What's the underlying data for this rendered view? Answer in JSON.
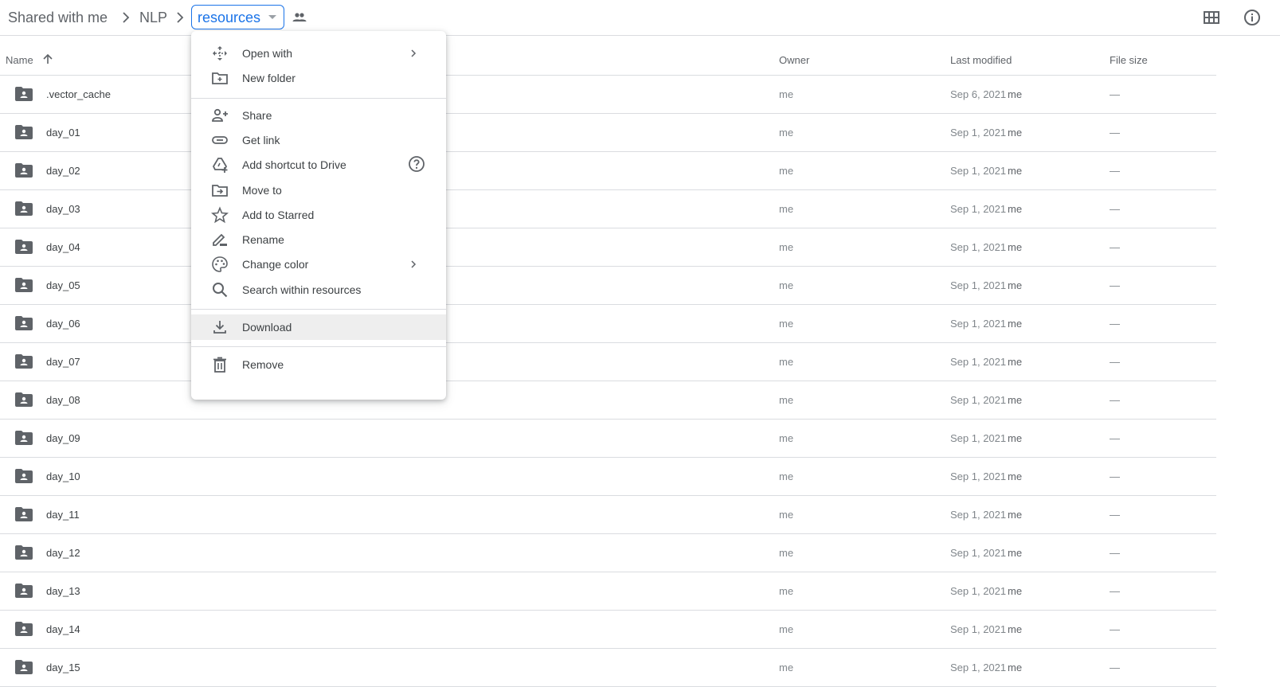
{
  "breadcrumb": {
    "items": [
      "Shared with me",
      "NLP"
    ],
    "current": "resources"
  },
  "toolbar": {
    "grid_view_icon": "grid-view-icon",
    "info_icon": "info-icon"
  },
  "table": {
    "columns": {
      "name": "Name",
      "owner": "Owner",
      "last_modified": "Last modified",
      "file_size": "File size"
    },
    "sort": "ascending",
    "rows": [
      {
        "name": ".vector_cache",
        "owner": "me",
        "date": "Sep 6, 2021",
        "modified_by": "me",
        "size": "—"
      },
      {
        "name": "day_01",
        "owner": "me",
        "date": "Sep 1, 2021",
        "modified_by": "me",
        "size": "—"
      },
      {
        "name": "day_02",
        "owner": "me",
        "date": "Sep 1, 2021",
        "modified_by": "me",
        "size": "—"
      },
      {
        "name": "day_03",
        "owner": "me",
        "date": "Sep 1, 2021",
        "modified_by": "me",
        "size": "—"
      },
      {
        "name": "day_04",
        "owner": "me",
        "date": "Sep 1, 2021",
        "modified_by": "me",
        "size": "—"
      },
      {
        "name": "day_05",
        "owner": "me",
        "date": "Sep 1, 2021",
        "modified_by": "me",
        "size": "—"
      },
      {
        "name": "day_06",
        "owner": "me",
        "date": "Sep 1, 2021",
        "modified_by": "me",
        "size": "—"
      },
      {
        "name": "day_07",
        "owner": "me",
        "date": "Sep 1, 2021",
        "modified_by": "me",
        "size": "—"
      },
      {
        "name": "day_08",
        "owner": "me",
        "date": "Sep 1, 2021",
        "modified_by": "me",
        "size": "—"
      },
      {
        "name": "day_09",
        "owner": "me",
        "date": "Sep 1, 2021",
        "modified_by": "me",
        "size": "—"
      },
      {
        "name": "day_10",
        "owner": "me",
        "date": "Sep 1, 2021",
        "modified_by": "me",
        "size": "—"
      },
      {
        "name": "day_11",
        "owner": "me",
        "date": "Sep 1, 2021",
        "modified_by": "me",
        "size": "—"
      },
      {
        "name": "day_12",
        "owner": "me",
        "date": "Sep 1, 2021",
        "modified_by": "me",
        "size": "—"
      },
      {
        "name": "day_13",
        "owner": "me",
        "date": "Sep 1, 2021",
        "modified_by": "me",
        "size": "—"
      },
      {
        "name": "day_14",
        "owner": "me",
        "date": "Sep 1, 2021",
        "modified_by": "me",
        "size": "—"
      },
      {
        "name": "day_15",
        "owner": "me",
        "date": "Sep 1, 2021",
        "modified_by": "me",
        "size": "—"
      }
    ]
  },
  "context_menu": {
    "items": [
      {
        "label": "Open with",
        "icon": "open-with-icon",
        "submenu": true
      },
      {
        "label": "New folder",
        "icon": "new-folder-icon"
      },
      {
        "label": "Share",
        "icon": "share-icon"
      },
      {
        "label": "Get link",
        "icon": "link-icon"
      },
      {
        "label": "Add shortcut to Drive",
        "icon": "add-shortcut-icon",
        "help": true
      },
      {
        "label": "Move to",
        "icon": "move-to-icon"
      },
      {
        "label": "Add to Starred",
        "icon": "star-icon"
      },
      {
        "label": "Rename",
        "icon": "rename-icon"
      },
      {
        "label": "Change color",
        "icon": "palette-icon",
        "submenu": true
      },
      {
        "label": "Search within resources",
        "icon": "search-icon"
      },
      {
        "label": "Download",
        "icon": "download-icon",
        "highlighted": true
      },
      {
        "label": "Remove",
        "icon": "trash-icon"
      }
    ]
  },
  "colors": {
    "accent": "#1a73e8",
    "icon": "#5f6368",
    "divider": "#dadce0",
    "highlight": "#eeeeee"
  }
}
